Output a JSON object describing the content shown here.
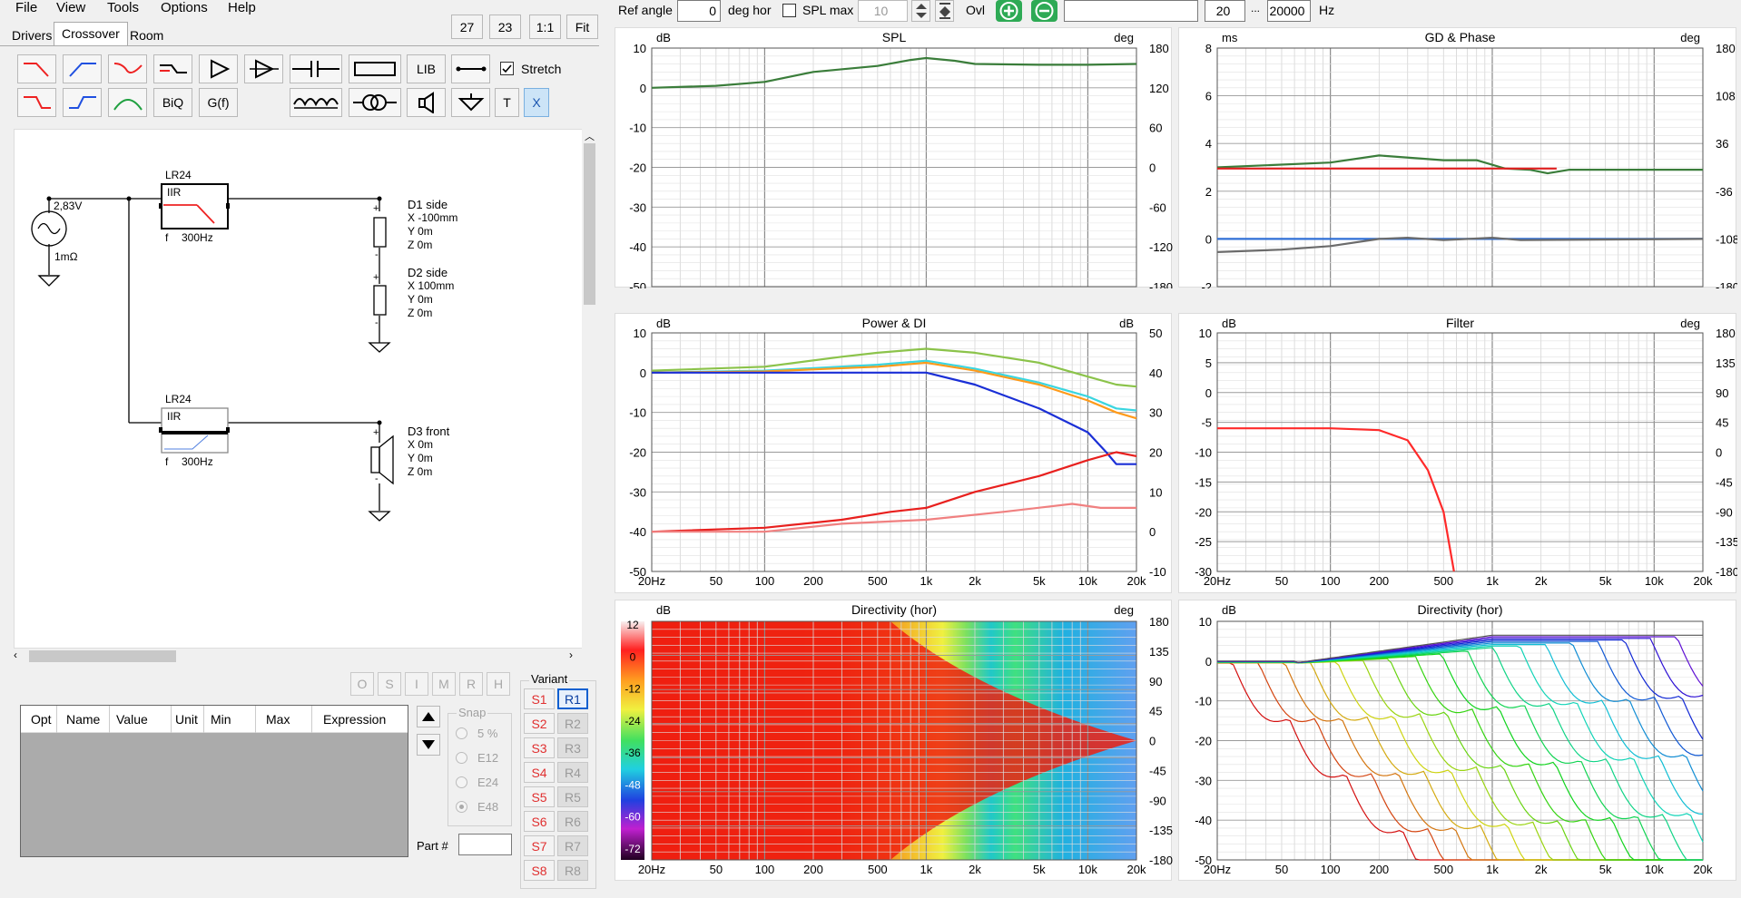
{
  "menu": [
    "File",
    "View",
    "Tools",
    "Options",
    "Help"
  ],
  "tabs": [
    "Drivers",
    "Crossover",
    "Room"
  ],
  "zoom": {
    "a": "27",
    "b": "23",
    "c": "1:1",
    "d": "Fit"
  },
  "toolbar": {
    "lib": "LIB",
    "biq": "BiQ",
    "gf": "G(f)",
    "t": "T",
    "x": "X",
    "stretch": "Stretch"
  },
  "schematic": {
    "source_voltage": "2,83V",
    "source_impedance": "1mΩ",
    "block1": {
      "title": "LR24",
      "type": "IIR",
      "f_label": "f",
      "freq": "300Hz"
    },
    "block2": {
      "title": "LR24",
      "type": "IIR",
      "f_label": "f",
      "freq": "300Hz"
    },
    "d1": {
      "name": "D1 side",
      "x": "X -100mm",
      "y": "Y 0m",
      "z": "Z 0m"
    },
    "d2": {
      "name": "D2 side",
      "x": "X 100mm",
      "y": "Y 0m",
      "z": "Z 0m"
    },
    "d3": {
      "name": "D3 front",
      "x": "X 0m",
      "y": "Y 0m",
      "z": "Z 0m"
    }
  },
  "opt_buttons": [
    "O",
    "S",
    "I",
    "M",
    "R",
    "H"
  ],
  "table_headers": [
    "Opt",
    "Name",
    "Value",
    "Unit",
    "Min",
    "Max",
    "Expression"
  ],
  "snap": {
    "title": "Snap",
    "options": [
      "5 %",
      "E12",
      "E24",
      "E48"
    ],
    "selected": "E48"
  },
  "part_label": "Part #",
  "variant": {
    "title": "Variant",
    "s": [
      "S1",
      "S2",
      "S3",
      "S4",
      "S5",
      "S6",
      "S7",
      "S8"
    ],
    "r": [
      "R1",
      "R2",
      "R3",
      "R4",
      "R5",
      "R6",
      "R7",
      "R8"
    ],
    "selected": "R1"
  },
  "topbar": {
    "ref_angle_label": "Ref angle",
    "ref_angle": "0",
    "deg_hor": "deg hor",
    "spl_max_label": "SPL max",
    "spl_max": "10",
    "ovl": "Ovl",
    "overlay": "",
    "f_min": "20",
    "dots": "...",
    "f_max": "20000",
    "hz": "Hz"
  },
  "freq_ticks": [
    "20Hz",
    "50",
    "100",
    "200",
    "500",
    "1k",
    "2k",
    "5k",
    "10k",
    "20k"
  ],
  "charts": {
    "spl": {
      "title": "SPL",
      "left_unit": "dB",
      "right_unit": "deg",
      "left_ticks": [
        "10",
        "0",
        "-10",
        "-20",
        "-30",
        "-40",
        "-50"
      ],
      "right_ticks": [
        "180",
        "120",
        "60",
        "0",
        "-60",
        "-120",
        "-180"
      ]
    },
    "gd": {
      "title": "GD & Phase",
      "left_unit": "ms",
      "right_unit": "deg",
      "left_ticks": [
        "8",
        "6",
        "4",
        "2",
        "0",
        "-2"
      ],
      "right_ticks": [
        "180",
        "108",
        "36",
        "-36",
        "-108",
        "-180"
      ]
    },
    "power": {
      "title": "Power & DI",
      "left_unit": "dB",
      "right_unit": "dB",
      "left_ticks": [
        "10",
        "0",
        "-10",
        "-20",
        "-30",
        "-40",
        "-50"
      ],
      "right_ticks": [
        "50",
        "40",
        "30",
        "20",
        "10",
        "0",
        "-10"
      ]
    },
    "filter": {
      "title": "Filter",
      "left_unit": "dB",
      "right_unit": "deg",
      "left_ticks": [
        "10",
        "5",
        "0",
        "-5",
        "-10",
        "-15",
        "-20",
        "-25",
        "-30"
      ],
      "right_ticks": [
        "180",
        "135",
        "90",
        "45",
        "0",
        "-45",
        "-90",
        "-135",
        "-180"
      ]
    },
    "dirmap": {
      "title": "Directivity (hor)",
      "left_unit": "dB",
      "right_unit": "deg",
      "left_ticks": [
        "12",
        "0",
        "-12",
        "-24",
        "-36",
        "-48",
        "-60",
        "-72"
      ],
      "right_ticks": [
        "180",
        "135",
        "90",
        "45",
        "0",
        "-45",
        "-90",
        "-135",
        "-180"
      ]
    },
    "dirlines": {
      "title": "Directivity (hor)",
      "left_unit": "dB",
      "left_ticks": [
        "10",
        "0",
        "-10",
        "-20",
        "-30",
        "-40",
        "-50"
      ]
    }
  },
  "chart_data": [
    {
      "type": "line",
      "title": "SPL",
      "xlabel": "",
      "ylabel": "dB",
      "xlim": [
        20,
        20000
      ],
      "ylim": [
        -50,
        10
      ],
      "xscale": "log",
      "series": [
        {
          "color": "#3a7d3a",
          "points": [
            [
              20,
              0
            ],
            [
              50,
              0.5
            ],
            [
              100,
              1.5
            ],
            [
              200,
              4
            ],
            [
              500,
              5.5
            ],
            [
              800,
              7
            ],
            [
              1000,
              7.5
            ],
            [
              1500,
              6.8
            ],
            [
              2000,
              6
            ],
            [
              5000,
              5.8
            ],
            [
              10000,
              5.8
            ],
            [
              20000,
              6
            ]
          ]
        }
      ]
    },
    {
      "type": "line",
      "title": "GD & Phase",
      "xlabel": "",
      "ylabel": "ms",
      "xlim": [
        20,
        20000
      ],
      "ylim": [
        -2,
        8
      ],
      "xscale": "log",
      "series": [
        {
          "color": "#3a7d3a",
          "points": [
            [
              20,
              3
            ],
            [
              100,
              3.2
            ],
            [
              200,
              3.5
            ],
            [
              500,
              3.3
            ],
            [
              800,
              3.3
            ],
            [
              1200,
              2.95
            ],
            [
              1700,
              2.9
            ],
            [
              2200,
              2.75
            ],
            [
              3000,
              2.9
            ],
            [
              20000,
              2.9
            ]
          ]
        },
        {
          "color": "#e02020",
          "points": [
            [
              20,
              2.95
            ],
            [
              2500,
              2.95
            ]
          ]
        },
        {
          "color": "#2f6fd6",
          "points": [
            [
              20,
              0
            ],
            [
              20000,
              0
            ]
          ]
        },
        {
          "color": "#6b6b6b",
          "points": [
            [
              20,
              -0.55
            ],
            [
              50,
              -0.45
            ],
            [
              100,
              -0.3
            ],
            [
              200,
              0
            ],
            [
              300,
              0.05
            ],
            [
              500,
              -0.05
            ],
            [
              1000,
              0.05
            ],
            [
              1500,
              -0.05
            ],
            [
              20000,
              0
            ]
          ]
        }
      ]
    },
    {
      "type": "line",
      "title": "Power & DI",
      "xlabel": "",
      "ylabel": "dB",
      "xlim": [
        20,
        20000
      ],
      "ylim": [
        -50,
        10
      ],
      "xscale": "log",
      "series": [
        {
          "color": "#8bc34a",
          "points": [
            [
              20,
              0.5
            ],
            [
              100,
              1.5
            ],
            [
              300,
              4
            ],
            [
              500,
              5
            ],
            [
              1000,
              6
            ],
            [
              2000,
              5
            ],
            [
              5000,
              2.5
            ],
            [
              10000,
              -1
            ],
            [
              15000,
              -3
            ],
            [
              20000,
              -3.5
            ]
          ]
        },
        {
          "color": "#3ad6e0",
          "points": [
            [
              20,
              0
            ],
            [
              100,
              0.5
            ],
            [
              500,
              2
            ],
            [
              1000,
              3
            ],
            [
              2000,
              1
            ],
            [
              5000,
              -2.5
            ],
            [
              10000,
              -6
            ],
            [
              15000,
              -9
            ],
            [
              20000,
              -9.5
            ]
          ]
        },
        {
          "color": "#ff9a1a",
          "points": [
            [
              20,
              0
            ],
            [
              100,
              0.3
            ],
            [
              500,
              1.5
            ],
            [
              1000,
              2.5
            ],
            [
              2000,
              0.5
            ],
            [
              5000,
              -3
            ],
            [
              10000,
              -7
            ],
            [
              15000,
              -10
            ],
            [
              20000,
              -11.5
            ]
          ]
        },
        {
          "color": "#1a2fd6",
          "points": [
            [
              20,
              0
            ],
            [
              100,
              0
            ],
            [
              500,
              0
            ],
            [
              1000,
              0
            ],
            [
              2000,
              -3
            ],
            [
              5000,
              -9
            ],
            [
              10000,
              -15
            ],
            [
              13000,
              -20
            ],
            [
              15000,
              -23
            ],
            [
              20000,
              -23
            ]
          ]
        },
        {
          "color": "#e8201e",
          "points": [
            [
              20,
              -40
            ],
            [
              100,
              -39
            ],
            [
              300,
              -37
            ],
            [
              600,
              -35
            ],
            [
              1000,
              -34
            ],
            [
              2000,
              -30
            ],
            [
              5000,
              -26
            ],
            [
              10000,
              -22
            ],
            [
              15000,
              -20
            ],
            [
              20000,
              -21
            ]
          ]
        },
        {
          "color": "#f08080",
          "points": [
            [
              20,
              -40
            ],
            [
              100,
              -40
            ],
            [
              300,
              -38
            ],
            [
              1000,
              -37
            ],
            [
              3000,
              -35
            ],
            [
              8000,
              -33
            ],
            [
              12000,
              -34
            ],
            [
              20000,
              -34
            ]
          ]
        }
      ]
    },
    {
      "type": "line",
      "title": "Filter",
      "xlabel": "",
      "ylabel": "dB",
      "xlim": [
        20,
        20000
      ],
      "ylim": [
        -30,
        10
      ],
      "xscale": "log",
      "series": [
        {
          "color": "#ff2a2a",
          "points": [
            [
              20,
              -6
            ],
            [
              100,
              -6
            ],
            [
              200,
              -6.3
            ],
            [
              300,
              -8
            ],
            [
              400,
              -13
            ],
            [
              500,
              -20
            ],
            [
              580,
              -30
            ]
          ]
        }
      ]
    },
    {
      "type": "heatmap",
      "title": "Directivity (hor)",
      "xlabel": "",
      "ylabel": "deg",
      "xlim": [
        20,
        20000
      ],
      "ylim": [
        -180,
        180
      ],
      "zlim": [
        -72,
        12
      ]
    },
    {
      "type": "line",
      "title": "Directivity (hor)",
      "xlabel": "",
      "ylabel": "dB",
      "xlim": [
        20,
        20000
      ],
      "ylim": [
        -50,
        10
      ],
      "xscale": "log",
      "series_count": 19
    }
  ]
}
